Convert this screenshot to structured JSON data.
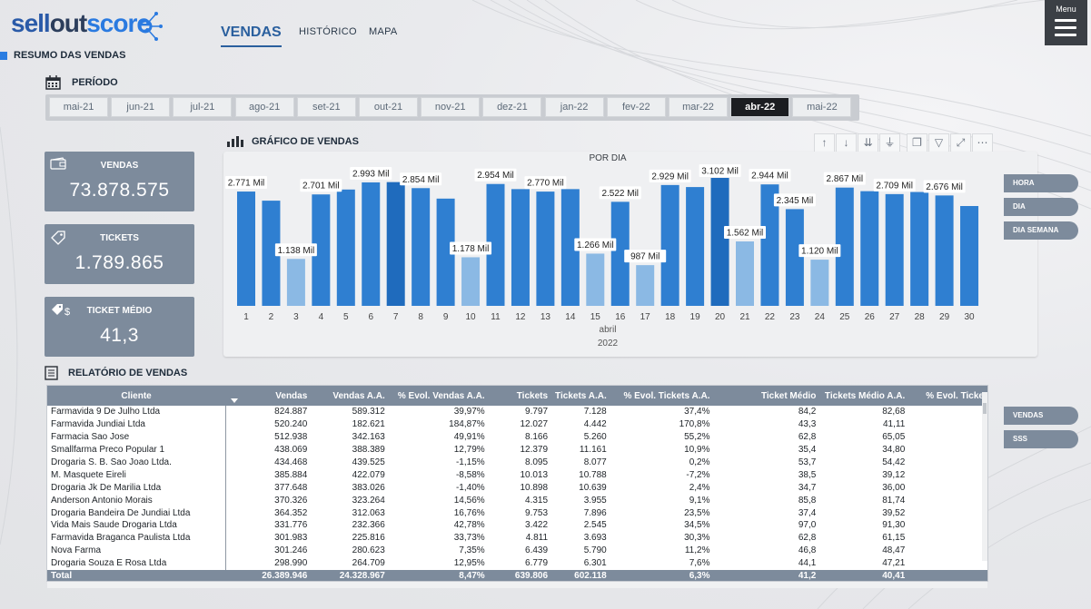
{
  "brand": {
    "part1": "sell",
    "part2": "out",
    "part3": "score"
  },
  "header": {
    "section_title": "RESUMO DAS VENDAS",
    "nav": {
      "vendas": "VENDAS",
      "historico": "HISTÓRICO",
      "mapa": "MAPA"
    },
    "menu_label": "Menu"
  },
  "periodo": {
    "title": "PERÍODO",
    "months": [
      "mai-21",
      "jun-21",
      "jul-21",
      "ago-21",
      "set-21",
      "out-21",
      "nov-21",
      "dez-21",
      "jan-22",
      "fev-22",
      "mar-22",
      "abr-22",
      "mai-22"
    ],
    "selected": "abr-22"
  },
  "kpis": {
    "vendas": {
      "label": "VENDAS",
      "value": "73.878.575"
    },
    "tickets": {
      "label": "TICKETS",
      "value": "1.789.865"
    },
    "ticket_medio": {
      "label": "TICKET MÉDIO",
      "value": "41,3"
    }
  },
  "chart_section": {
    "title": "GRÁFICO DE VENDAS"
  },
  "chart_data": {
    "type": "bar",
    "title": "POR DIA",
    "xlabel_month": "abril",
    "xlabel_year": "2022",
    "categories": [
      "1",
      "2",
      "3",
      "4",
      "5",
      "6",
      "7",
      "8",
      "9",
      "10",
      "11",
      "12",
      "13",
      "14",
      "15",
      "16",
      "17",
      "18",
      "19",
      "20",
      "21",
      "22",
      "23",
      "24",
      "25",
      "26",
      "27",
      "28",
      "29",
      "30"
    ],
    "values": [
      2771,
      2550,
      1138,
      2701,
      2820,
      2993,
      3000,
      2854,
      2600,
      1178,
      2954,
      2830,
      2770,
      2830,
      1266,
      2522,
      987,
      2929,
      2880,
      3102,
      1562,
      2944,
      2345,
      1120,
      2867,
      2780,
      2709,
      2760,
      2676,
      2420
    ],
    "data_labels": {
      "1": "2.771 Mil",
      "3": "1.138 Mil",
      "4": "2.701 Mil",
      "6": "2.993 Mil",
      "8": "2.854 Mil",
      "10": "1.178 Mil",
      "11": "2.954 Mil",
      "13": "2.770 Mil",
      "15": "1.266 Mil",
      "16": "2.522 Mil",
      "17": "987 Mil",
      "18": "2.929 Mil",
      "20": "3.102 Mil",
      "21": "1.562 Mil",
      "22": "2.944 Mil",
      "23": "2.345 Mil",
      "24": "1.120 Mil",
      "25": "2.867 Mil",
      "27": "2.709 Mil",
      "29": "2.676 Mil"
    },
    "ylim": [
      0,
      3300
    ],
    "colors": {
      "high": "#2f7fd1",
      "low": "#8bb9e4",
      "peak": "#1f6bbd"
    }
  },
  "chart_buttons": {
    "hora": "HORA",
    "dia": "DIA",
    "dia_semana": "DIA SEMANA"
  },
  "report": {
    "title": "RELATÓRIO DE VENDAS",
    "columns": [
      "Cliente",
      "Vendas",
      "Vendas A.A.",
      "% Evol. Vendas A.A.",
      "Tickets",
      "Tickets A.A.",
      "% Evol. Tickets A.A.",
      "Ticket Médio",
      "Tickets Médio A.A.",
      "% Evol. Ticke"
    ],
    "rows": [
      [
        "Farmavida 9 De Julho Ltda",
        "824.887",
        "589.312",
        "39,97%",
        "9.797",
        "7.128",
        "37,4%",
        "84,2",
        "82,68",
        ""
      ],
      [
        "Farmavida Jundiai Ltda",
        "520.240",
        "182.621",
        "184,87%",
        "12.027",
        "4.442",
        "170,8%",
        "43,3",
        "41,11",
        ""
      ],
      [
        "Farmacia Sao Jose",
        "512.938",
        "342.163",
        "49,91%",
        "8.166",
        "5.260",
        "55,2%",
        "62,8",
        "65,05",
        ""
      ],
      [
        "Smallfarma Preco Popular 1",
        "438.069",
        "388.389",
        "12,79%",
        "12.379",
        "11.161",
        "10,9%",
        "35,4",
        "34,80",
        ""
      ],
      [
        "Drogaria S. B. Sao Joao Ltda.",
        "434.468",
        "439.525",
        "-1,15%",
        "8.095",
        "8.077",
        "0,2%",
        "53,7",
        "54,42",
        ""
      ],
      [
        "M. Masquete Eireli",
        "385.884",
        "422.079",
        "-8,58%",
        "10.013",
        "10.788",
        "-7,2%",
        "38,5",
        "39,12",
        ""
      ],
      [
        "Drogaria Jk De Marilia Ltda",
        "377.648",
        "383.026",
        "-1,40%",
        "10.898",
        "10.639",
        "2,4%",
        "34,7",
        "36,00",
        ""
      ],
      [
        "Anderson Antonio Morais",
        "370.326",
        "323.264",
        "14,56%",
        "4.315",
        "3.955",
        "9,1%",
        "85,8",
        "81,74",
        ""
      ],
      [
        "Drogaria Bandeira De Jundiai Ltda",
        "364.352",
        "312.063",
        "16,76%",
        "9.753",
        "7.896",
        "23,5%",
        "37,4",
        "39,52",
        ""
      ],
      [
        "Vida Mais Saude Drogaria Ltda",
        "331.776",
        "232.366",
        "42,78%",
        "3.422",
        "2.545",
        "34,5%",
        "97,0",
        "91,30",
        ""
      ],
      [
        "Farmavida Braganca Paulista Ltda",
        "301.983",
        "225.816",
        "33,73%",
        "4.811",
        "3.693",
        "30,3%",
        "62,8",
        "61,15",
        ""
      ],
      [
        "Nova Farma",
        "301.246",
        "280.623",
        "7,35%",
        "6.439",
        "5.790",
        "11,2%",
        "46,8",
        "48,47",
        ""
      ],
      [
        "Drogaria Souza E Rosa Ltda",
        "298.990",
        "264.709",
        "12,95%",
        "6.779",
        "6.301",
        "7,6%",
        "44,1",
        "47,21",
        ""
      ]
    ],
    "total": [
      "Total",
      "26.389.946",
      "24.328.967",
      "8,47%",
      "639.806",
      "602.118",
      "6,3%",
      "41,2",
      "40,41",
      ""
    ]
  },
  "report_buttons": {
    "vendas": "VENDAS",
    "sss": "SSS"
  }
}
